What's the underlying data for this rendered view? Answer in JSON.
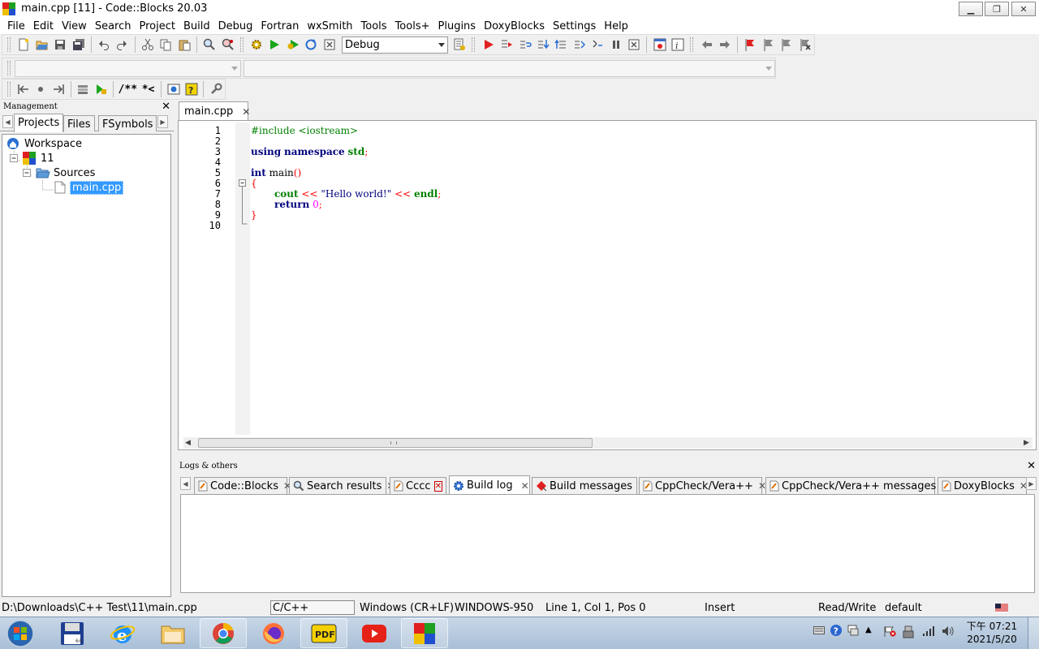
{
  "window": {
    "title": "main.cpp [11] - Code::Blocks 20.03",
    "controls": {
      "minimize": "▁",
      "maximize": "❐",
      "close": "✕"
    }
  },
  "menu": [
    "File",
    "Edit",
    "View",
    "Search",
    "Project",
    "Build",
    "Debug",
    "Fortran",
    "wxSmith",
    "Tools",
    "Tools+",
    "Plugins",
    "DoxyBlocks",
    "Settings",
    "Help"
  ],
  "toolbar": {
    "build_target": "Debug",
    "symbol_combo_1": "",
    "symbol_combo_2": "",
    "doxy_comment_block": "/**",
    "doxy_line_comment": "*<"
  },
  "management": {
    "caption": "Management",
    "close": "✕",
    "tabs": [
      "Projects",
      "Files",
      "FSymbols"
    ],
    "tree": {
      "workspace": "Workspace",
      "project": "11",
      "folder": "Sources",
      "file": "main.cpp"
    }
  },
  "editor": {
    "tab_label": "main.cpp",
    "tab_close": "✕",
    "line_numbers": [
      "1",
      "2",
      "3",
      "4",
      "5",
      "6",
      "7",
      "8",
      "9",
      "10"
    ],
    "code": {
      "l1": "#include <iostream>",
      "l3_kw1": "using",
      "l3_kw2": "namespace",
      "l3_id": "std",
      "l3_semi": ";",
      "l5_kw": "int",
      "l5_id": "main",
      "l5_paren": "()",
      "l6": "{",
      "l7_cout": "cout",
      "l7_op1": "<<",
      "l7_str": "\"Hello world!\"",
      "l7_op2": "<<",
      "l7_endl": "endl",
      "l7_semi": ";",
      "l8_kw": "return",
      "l8_num": "0",
      "l8_semi": ";",
      "l9": "}"
    }
  },
  "logs": {
    "caption": "Logs & others",
    "close": "✕",
    "tabs": [
      "Code::Blocks",
      "Search results",
      "Cccc",
      "Build log",
      "Build messages",
      "CppCheck/Vera++",
      "CppCheck/Vera++ messages",
      "DoxyBlocks"
    ],
    "active_tab": "Build log"
  },
  "status": {
    "path": "D:\\Downloads\\C++ Test\\11\\main.cpp",
    "language": "C/C++",
    "eol": "Windows (CR+LF)",
    "encoding": "WINDOWS-950",
    "position": "Line 1, Col 1, Pos 0",
    "mode": "Insert",
    "access": "Read/Write",
    "profile": "default"
  },
  "taskbar": {
    "time": "下午 07:21",
    "date": "2021/5/20",
    "floppy_label": "64",
    "pdf_label": "PDF"
  },
  "colors": {
    "keyword": "#00007f",
    "preprocessor": "#008000",
    "operator": "#ff0000",
    "number": "#ff00ff",
    "selection": "#3399ff"
  }
}
